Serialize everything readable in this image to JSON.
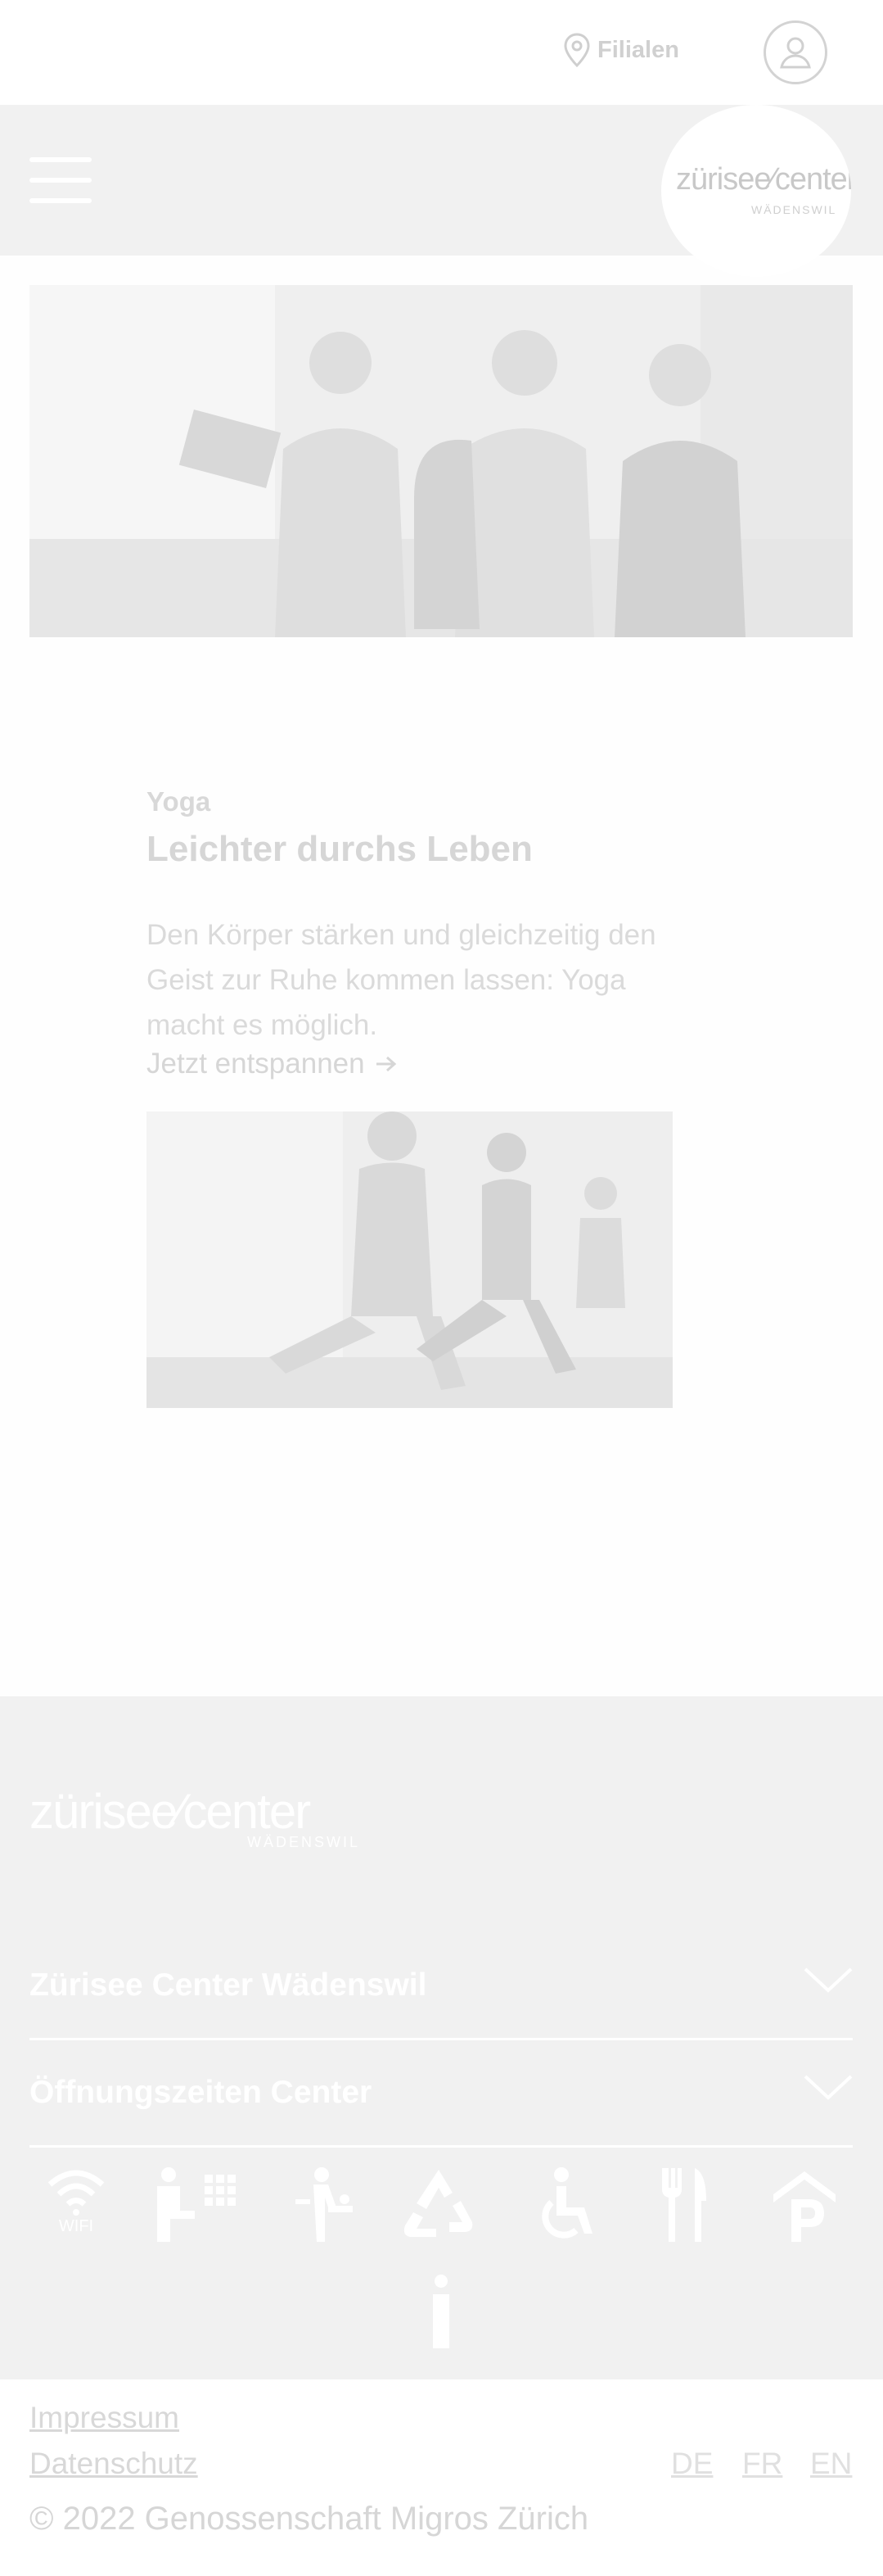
{
  "header": {
    "filialen_label": "Filialen",
    "location_icon": "map-pin-icon",
    "user_icon": "user-icon"
  },
  "nav": {
    "menu_icon": "hamburger-menu-icon",
    "logo_text": "zürisee⁄center",
    "logo_subtext": "WÄDENSWIL"
  },
  "hero": {
    "image": "three-men-with-laptop-photo"
  },
  "article": {
    "kicker": "Yoga",
    "title": "Leichter durchs Leben",
    "description": "Den Körper stärken und gleichzeitig den Geist zur Ruhe kommen lassen: Yoga macht es möglich.",
    "cta_label": "Jetzt entspannen",
    "cta_icon": "arrow-right-icon",
    "image": "yoga-class-photo"
  },
  "footer": {
    "logo_text": "zürisee⁄center",
    "logo_subtext": "WÄDENSWIL",
    "accordions": [
      {
        "title": "Zürisee Center Wädenswil"
      },
      {
        "title": "Öffnungszeiten Center"
      }
    ],
    "amenities": [
      {
        "icon": "wifi-icon",
        "label": "WIFI"
      },
      {
        "icon": "info-terminal-icon",
        "label": ""
      },
      {
        "icon": "baby-changing-icon",
        "label": ""
      },
      {
        "icon": "recycling-icon",
        "label": ""
      },
      {
        "icon": "wheelchair-icon",
        "label": ""
      },
      {
        "icon": "restaurant-icon",
        "label": ""
      },
      {
        "icon": "parking-garage-icon",
        "label": ""
      },
      {
        "icon": "information-icon",
        "label": ""
      }
    ]
  },
  "legal": {
    "impressum": "Impressum",
    "datenschutz": "Datenschutz",
    "languages": [
      "DE",
      "FR",
      "EN"
    ],
    "copyright": "© 2022 Genossenschaft Migros Zürich"
  },
  "colors": {
    "footer_bg": "#f1f1f1",
    "nav_bg": "#f1f1f1",
    "text_muted": "#d6d6d6"
  }
}
